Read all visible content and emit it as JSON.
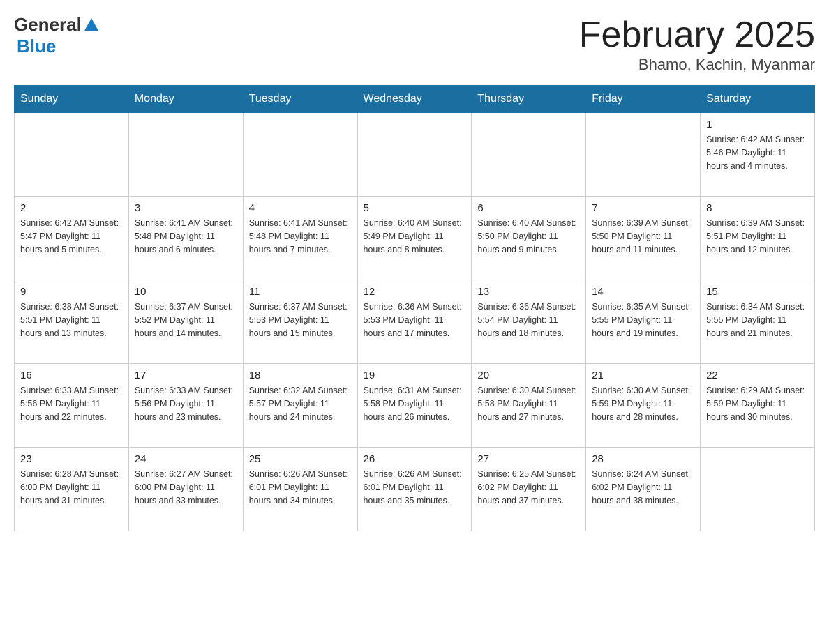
{
  "header": {
    "title": "February 2025",
    "subtitle": "Bhamo, Kachin, Myanmar",
    "logo_general": "General",
    "logo_blue": "Blue"
  },
  "days_of_week": [
    "Sunday",
    "Monday",
    "Tuesday",
    "Wednesday",
    "Thursday",
    "Friday",
    "Saturday"
  ],
  "weeks": [
    {
      "cells": [
        {
          "day": "",
          "info": ""
        },
        {
          "day": "",
          "info": ""
        },
        {
          "day": "",
          "info": ""
        },
        {
          "day": "",
          "info": ""
        },
        {
          "day": "",
          "info": ""
        },
        {
          "day": "",
          "info": ""
        },
        {
          "day": "1",
          "info": "Sunrise: 6:42 AM\nSunset: 5:46 PM\nDaylight: 11 hours and 4 minutes."
        }
      ]
    },
    {
      "cells": [
        {
          "day": "2",
          "info": "Sunrise: 6:42 AM\nSunset: 5:47 PM\nDaylight: 11 hours and 5 minutes."
        },
        {
          "day": "3",
          "info": "Sunrise: 6:41 AM\nSunset: 5:48 PM\nDaylight: 11 hours and 6 minutes."
        },
        {
          "day": "4",
          "info": "Sunrise: 6:41 AM\nSunset: 5:48 PM\nDaylight: 11 hours and 7 minutes."
        },
        {
          "day": "5",
          "info": "Sunrise: 6:40 AM\nSunset: 5:49 PM\nDaylight: 11 hours and 8 minutes."
        },
        {
          "day": "6",
          "info": "Sunrise: 6:40 AM\nSunset: 5:50 PM\nDaylight: 11 hours and 9 minutes."
        },
        {
          "day": "7",
          "info": "Sunrise: 6:39 AM\nSunset: 5:50 PM\nDaylight: 11 hours and 11 minutes."
        },
        {
          "day": "8",
          "info": "Sunrise: 6:39 AM\nSunset: 5:51 PM\nDaylight: 11 hours and 12 minutes."
        }
      ]
    },
    {
      "cells": [
        {
          "day": "9",
          "info": "Sunrise: 6:38 AM\nSunset: 5:51 PM\nDaylight: 11 hours and 13 minutes."
        },
        {
          "day": "10",
          "info": "Sunrise: 6:37 AM\nSunset: 5:52 PM\nDaylight: 11 hours and 14 minutes."
        },
        {
          "day": "11",
          "info": "Sunrise: 6:37 AM\nSunset: 5:53 PM\nDaylight: 11 hours and 15 minutes."
        },
        {
          "day": "12",
          "info": "Sunrise: 6:36 AM\nSunset: 5:53 PM\nDaylight: 11 hours and 17 minutes."
        },
        {
          "day": "13",
          "info": "Sunrise: 6:36 AM\nSunset: 5:54 PM\nDaylight: 11 hours and 18 minutes."
        },
        {
          "day": "14",
          "info": "Sunrise: 6:35 AM\nSunset: 5:55 PM\nDaylight: 11 hours and 19 minutes."
        },
        {
          "day": "15",
          "info": "Sunrise: 6:34 AM\nSunset: 5:55 PM\nDaylight: 11 hours and 21 minutes."
        }
      ]
    },
    {
      "cells": [
        {
          "day": "16",
          "info": "Sunrise: 6:33 AM\nSunset: 5:56 PM\nDaylight: 11 hours and 22 minutes."
        },
        {
          "day": "17",
          "info": "Sunrise: 6:33 AM\nSunset: 5:56 PM\nDaylight: 11 hours and 23 minutes."
        },
        {
          "day": "18",
          "info": "Sunrise: 6:32 AM\nSunset: 5:57 PM\nDaylight: 11 hours and 24 minutes."
        },
        {
          "day": "19",
          "info": "Sunrise: 6:31 AM\nSunset: 5:58 PM\nDaylight: 11 hours and 26 minutes."
        },
        {
          "day": "20",
          "info": "Sunrise: 6:30 AM\nSunset: 5:58 PM\nDaylight: 11 hours and 27 minutes."
        },
        {
          "day": "21",
          "info": "Sunrise: 6:30 AM\nSunset: 5:59 PM\nDaylight: 11 hours and 28 minutes."
        },
        {
          "day": "22",
          "info": "Sunrise: 6:29 AM\nSunset: 5:59 PM\nDaylight: 11 hours and 30 minutes."
        }
      ]
    },
    {
      "cells": [
        {
          "day": "23",
          "info": "Sunrise: 6:28 AM\nSunset: 6:00 PM\nDaylight: 11 hours and 31 minutes."
        },
        {
          "day": "24",
          "info": "Sunrise: 6:27 AM\nSunset: 6:00 PM\nDaylight: 11 hours and 33 minutes."
        },
        {
          "day": "25",
          "info": "Sunrise: 6:26 AM\nSunset: 6:01 PM\nDaylight: 11 hours and 34 minutes."
        },
        {
          "day": "26",
          "info": "Sunrise: 6:26 AM\nSunset: 6:01 PM\nDaylight: 11 hours and 35 minutes."
        },
        {
          "day": "27",
          "info": "Sunrise: 6:25 AM\nSunset: 6:02 PM\nDaylight: 11 hours and 37 minutes."
        },
        {
          "day": "28",
          "info": "Sunrise: 6:24 AM\nSunset: 6:02 PM\nDaylight: 11 hours and 38 minutes."
        },
        {
          "day": "",
          "info": ""
        }
      ]
    }
  ]
}
